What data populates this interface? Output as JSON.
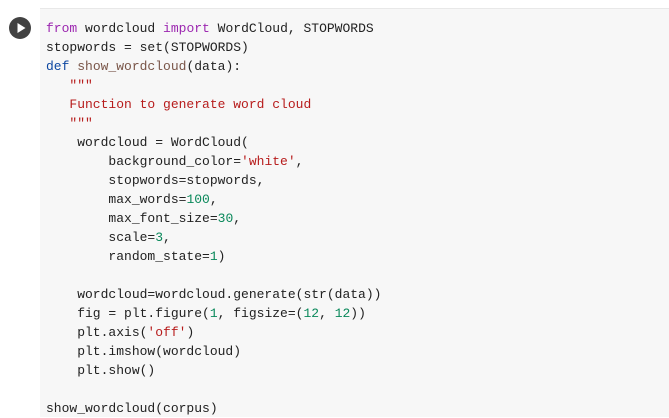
{
  "run_button": {
    "icon": "play-icon"
  },
  "code_lines": [
    [
      {
        "t": "from",
        "c": "kw"
      },
      {
        "t": " wordcloud ",
        "c": "plain"
      },
      {
        "t": "import",
        "c": "kw"
      },
      {
        "t": " WordCloud, STOPWORDS",
        "c": "plain"
      }
    ],
    [
      {
        "t": "stopwords = set(STOPWORDS)",
        "c": "plain"
      }
    ],
    [
      {
        "t": "def",
        "c": "kwdef"
      },
      {
        "t": " ",
        "c": "plain"
      },
      {
        "t": "show_wordcloud",
        "c": "fn"
      },
      {
        "t": "(data):",
        "c": "plain"
      }
    ],
    [
      {
        "t": "   \"\"\"",
        "c": "str"
      }
    ],
    [
      {
        "t": "   Function to generate word cloud",
        "c": "str"
      }
    ],
    [
      {
        "t": "   \"\"\"",
        "c": "str"
      }
    ],
    [
      {
        "t": "    wordcloud = WordCloud(",
        "c": "plain"
      }
    ],
    [
      {
        "t": "        background_color=",
        "c": "plain"
      },
      {
        "t": "'white'",
        "c": "str"
      },
      {
        "t": ",",
        "c": "plain"
      }
    ],
    [
      {
        "t": "        stopwords=stopwords,",
        "c": "plain"
      }
    ],
    [
      {
        "t": "        max_words=",
        "c": "plain"
      },
      {
        "t": "100",
        "c": "num"
      },
      {
        "t": ",",
        "c": "plain"
      }
    ],
    [
      {
        "t": "        max_font_size=",
        "c": "plain"
      },
      {
        "t": "30",
        "c": "num"
      },
      {
        "t": ",",
        "c": "plain"
      }
    ],
    [
      {
        "t": "        scale=",
        "c": "plain"
      },
      {
        "t": "3",
        "c": "num"
      },
      {
        "t": ",",
        "c": "plain"
      }
    ],
    [
      {
        "t": "        random_state=",
        "c": "plain"
      },
      {
        "t": "1",
        "c": "num"
      },
      {
        "t": ")",
        "c": "plain"
      }
    ],
    [
      {
        "t": "",
        "c": "plain"
      }
    ],
    [
      {
        "t": "    wordcloud=wordcloud.generate(str(data))",
        "c": "plain"
      }
    ],
    [
      {
        "t": "    fig = plt.figure(",
        "c": "plain"
      },
      {
        "t": "1",
        "c": "num"
      },
      {
        "t": ", figsize=(",
        "c": "plain"
      },
      {
        "t": "12",
        "c": "num"
      },
      {
        "t": ", ",
        "c": "plain"
      },
      {
        "t": "12",
        "c": "num"
      },
      {
        "t": "))",
        "c": "plain"
      }
    ],
    [
      {
        "t": "    plt.axis(",
        "c": "plain"
      },
      {
        "t": "'off'",
        "c": "str"
      },
      {
        "t": ")",
        "c": "plain"
      }
    ],
    [
      {
        "t": "    plt.imshow(wordcloud)",
        "c": "plain"
      }
    ],
    [
      {
        "t": "    plt.show()",
        "c": "plain"
      }
    ],
    [
      {
        "t": "",
        "c": "plain"
      }
    ],
    [
      {
        "t": "show_wordcloud(corpus)",
        "c": "plain"
      }
    ]
  ]
}
